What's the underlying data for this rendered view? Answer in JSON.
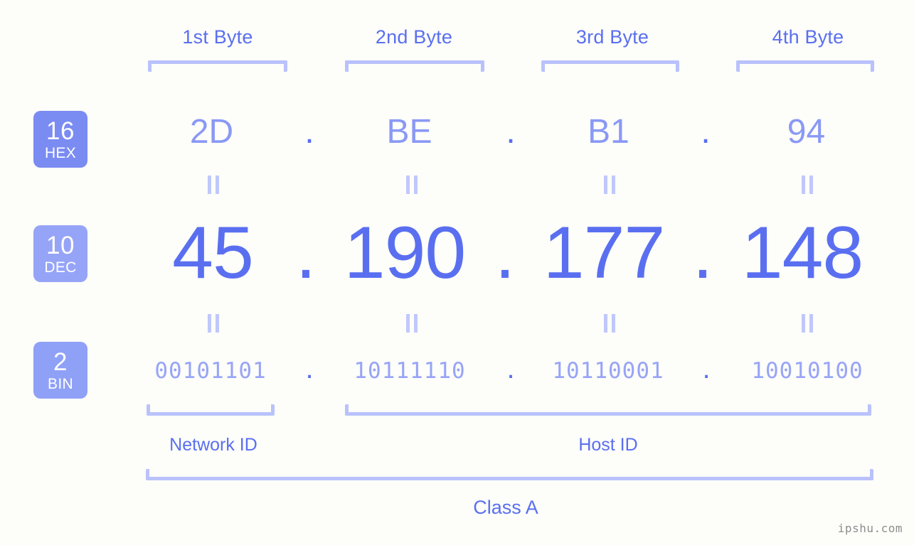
{
  "meta": {
    "background": "#fdfdfa",
    "accent": "#5a6ff0",
    "accent_light": "#8a99f5",
    "accent_pale": "#b9c2fb",
    "badge_hex_color": "#7a8bf2",
    "badge_dec_color": "#96a4f7",
    "badge_bin_color": "#8fa0f7",
    "watermark": "ipshu.com"
  },
  "headers": {
    "byte1": "1st Byte",
    "byte2": "2nd Byte",
    "byte3": "3rd Byte",
    "byte4": "4th Byte"
  },
  "bases": {
    "hex": {
      "number": "16",
      "system": "HEX"
    },
    "dec": {
      "number": "10",
      "system": "DEC"
    },
    "bin": {
      "number": "2",
      "system": "BIN"
    }
  },
  "separators": {
    "dot": ".",
    "equals": "∥"
  },
  "rows": {
    "hex": {
      "octets": [
        "2D",
        "BE",
        "B1",
        "94"
      ],
      "dots": [
        ".",
        ".",
        "."
      ]
    },
    "dec": {
      "octets": [
        "45",
        "190",
        "177",
        "148"
      ],
      "dots": [
        ".",
        ".",
        "."
      ]
    },
    "bin": {
      "octets": [
        "00101101",
        "10111110",
        "10110001",
        "10010100"
      ],
      "dots": [
        ".",
        ".",
        "."
      ]
    }
  },
  "footer": {
    "network_id_label": "Network ID",
    "host_id_label": "Host ID",
    "class_label": "Class A"
  },
  "address": {
    "hex": "2D.BE.B1.94",
    "dec": "45.190.177.148",
    "bin": "00101101.10111110.10110001.10010100"
  }
}
